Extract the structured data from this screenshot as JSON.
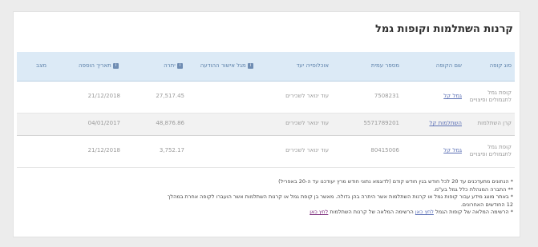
{
  "title": "קרנות השתלמות וקופות גמל",
  "columns": [
    "סוג קופה",
    "שם הקופה",
    "מספר עמית",
    "אוכלוסייה יעד",
    "מגל אישור ההודעה",
    "יתרה",
    "תאריך הוספה",
    "מצב"
  ],
  "rows": [
    [
      "קופת גמל לתגמולים ופיצויים",
      "גמל קל",
      "7508231",
      "עוד ינואר לשכירים",
      "",
      "27,517.45",
      "21/12/2018",
      ""
    ],
    [
      "קרן השתלמות",
      "השתלמות קל",
      "5571789201",
      "עוד ינואר לשכירים",
      "",
      "48,876.86",
      "04/01/2017",
      ""
    ],
    [
      "קופת גמל לתגמולים ופיצויים",
      "גמל קל",
      "80415006",
      "עוד ינואר לשכירים",
      "",
      "3,752.17",
      "21/12/2018",
      ""
    ]
  ],
  "notes": [
    "* הנתונים מתעדכנים עד 20 לכל חודש בגין חודש קודם (לדוגמא נתוני חודש מרץ יעודכנו עד ה-20 באפריל)",
    "** התברה המנהלת כלל גמל בע\"מ.",
    "* באתר מוצג מידע עבור קופות גמל או קרנות השתלמות אשר היתרה בהן גדולה. מאשר בן קופת גמל או קרנות השתלמות אשר הועברו לקופה אחרת במהלך",
    "12 החודשים האחרונים."
  ],
  "footer": {
    "prefix": "* הרשימה המלאה של קופות הגמל",
    "link1": "לחץ כאן",
    "middle": "הרשימה המלאה של קרנות השתלמות",
    "link2": "לחץ כאן"
  },
  "colors": {
    "header_bg": "#dceaf6",
    "header_text": "#5a7fa8",
    "link": "#5a6fb5",
    "footer_link": "#7a2a7a"
  }
}
